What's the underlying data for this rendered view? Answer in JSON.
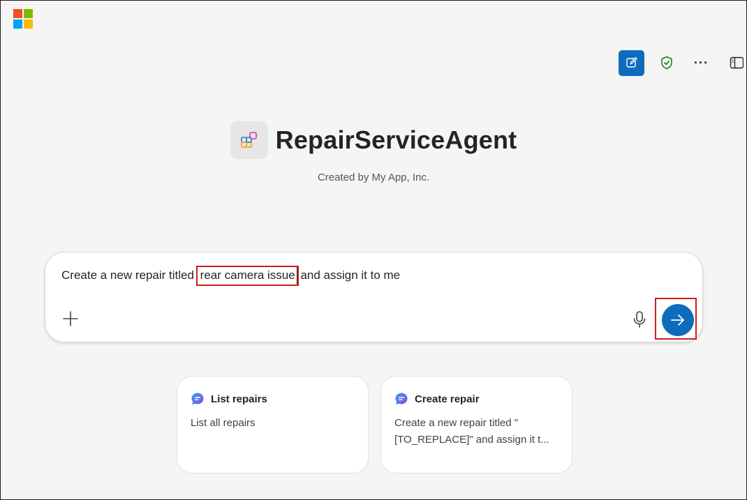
{
  "app": {
    "brand_colors": [
      "#f25022",
      "#7fba00",
      "#00a4ef",
      "#ffb900"
    ],
    "accent": "#0f6cbd",
    "highlight_outline": "#d11b1b"
  },
  "toolbar": {
    "buttons": [
      {
        "name": "new-chat",
        "icon": "compose-icon"
      },
      {
        "name": "privacy",
        "icon": "shield-check-icon"
      },
      {
        "name": "more",
        "icon": "more-icon",
        "label": "···"
      },
      {
        "name": "sidebar",
        "icon": "sidebar-icon"
      }
    ]
  },
  "agent": {
    "title": "RepairServiceAgent",
    "subtitle": "Created by My App, Inc."
  },
  "compose": {
    "text_before": "Create a new repair titled ",
    "text_highlight": "rear camera issue",
    "text_after": " and assign it to me"
  },
  "suggestions": [
    {
      "title": "List repairs",
      "body": "List all repairs"
    },
    {
      "title": "Create repair",
      "body_line1": "Create a new repair titled \"",
      "body_line2": "[TO_REPLACE]\" and assign it t..."
    }
  ]
}
